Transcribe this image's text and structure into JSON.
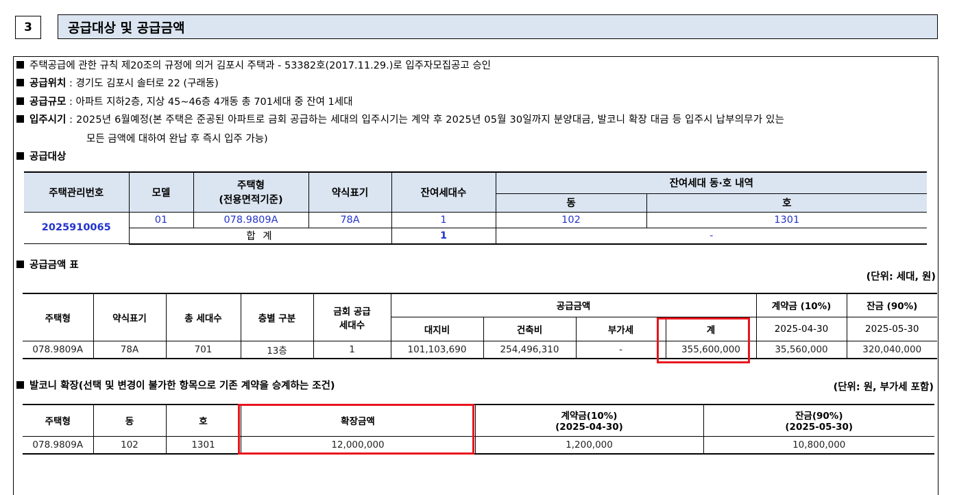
{
  "section": {
    "number": "3",
    "title": "공급대상 및 공급금액"
  },
  "notes": {
    "line1": "주택공급에 관한 규칙 제20조의 규정에 의거 김포시 주택과 - 53382호(2017.11.29.)로 입주자모집공고 승인",
    "location_label": "공급위치",
    "location_value": " : 경기도 김포시 솔터로 22 (구래동)",
    "scale_label": "공급규모",
    "scale_value": " : 아파트 지하2층, 지상 45~46층 4개동 총 701세대 중 잔여 1세대",
    "movein_label": "입주시기",
    "movein_value": " : 2025년 6월예정(본 주택은 준공된 아파트로 금회 공급하는 세대의 입주시기는 계약 후 2025년 05월 30일까지 분양대금, 발코니 확장 대금 등 입주시 납부의무가 있는",
    "movein_value2": "모든 금액에 대하여 완납 후 즉시 입주 가능)",
    "target_heading": "공급대상"
  },
  "supply_table": {
    "headers": {
      "mgmt_no": "주택관리번호",
      "model": "모델",
      "type_line1": "주택형",
      "type_line2": "(전용면적기준)",
      "abbr": "약식표기",
      "remaining": "잔여세대수",
      "detail": "잔여세대 동·호 내역",
      "dong": "동",
      "ho": "호"
    },
    "mgmt_no": "2025910065",
    "row": {
      "model": "01",
      "type": "078.9809A",
      "abbr": "78A",
      "remaining": "1",
      "dong": "102",
      "ho": "1301"
    },
    "total": {
      "label": "합 계",
      "remaining": "1",
      "detail": "-"
    }
  },
  "amount_section": {
    "heading": "공급금액 표",
    "unit": "(단위: 세대, 원)",
    "headers": {
      "type": "주택형",
      "abbr": "약식표기",
      "total_households": "총 세대수",
      "floor": "층별 구분",
      "this_supply_line1": "금회 공급",
      "this_supply_line2": "세대수",
      "supply_amount": "공급금액",
      "land": "대지비",
      "building": "건축비",
      "vat": "부가세",
      "sum": "계",
      "deposit": "계약금 (10%)",
      "balance": "잔금 (90%)",
      "deposit_date": "2025-04-30",
      "balance_date": "2025-05-30"
    },
    "row": {
      "type": "078.9809A",
      "abbr": "78A",
      "total_households": "701",
      "floor": "13층",
      "this_supply": "1",
      "land": "101,103,690",
      "building": "254,496,310",
      "vat": "-",
      "sum": "355,600,000",
      "deposit": "35,560,000",
      "balance": "320,040,000"
    }
  },
  "balcony_section": {
    "heading": "발코니 확장(선택 및 변경이 불가한 항목으로 기존 계약을 승계하는 조건)",
    "unit": "(단위: 원, 부가세 포함)",
    "headers": {
      "type": "주택형",
      "dong": "동",
      "ho": "호",
      "amount": "확장금액",
      "deposit_line1": "계약금(10%)",
      "deposit_line2": "(2025-04-30)",
      "balance_line1": "잔금(90%)",
      "balance_line2": "(2025-05-30)"
    },
    "row": {
      "type": "078.9809A",
      "dong": "102",
      "ho": "1301",
      "amount": "12,000,000",
      "deposit": "1,200,000",
      "balance": "10,800,000"
    }
  },
  "colors": {
    "header_bg": "#dbe5f1",
    "highlight": "#e8141c",
    "value_blue": "#2233cc"
  }
}
